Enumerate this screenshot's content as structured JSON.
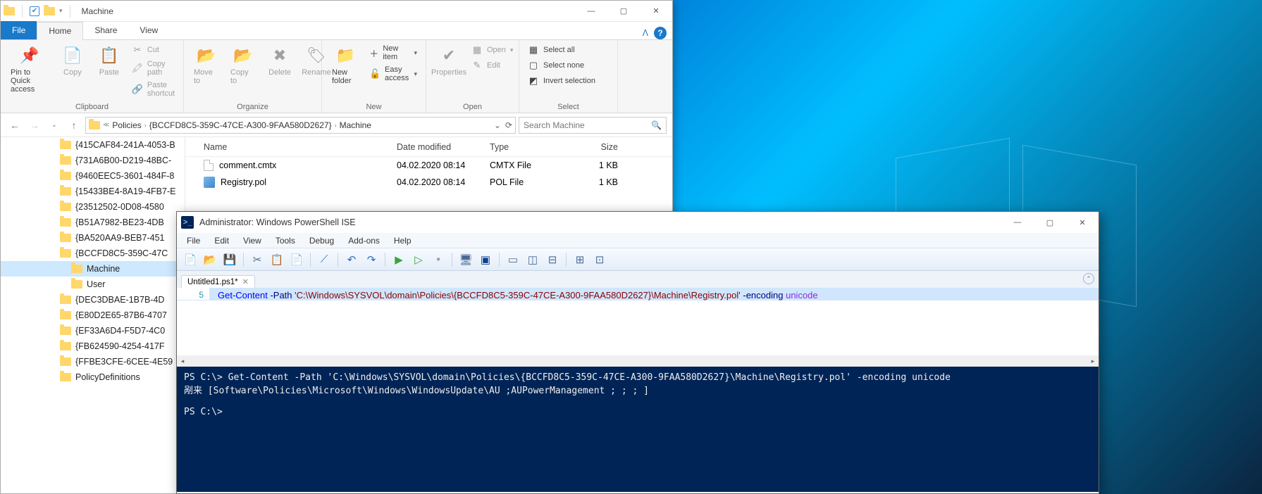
{
  "explorer": {
    "title": "Machine",
    "tabs": {
      "file": "File",
      "home": "Home",
      "share": "Share",
      "view": "View"
    },
    "ribbon": {
      "clipboard": {
        "label": "Clipboard",
        "pin": "Pin to Quick access",
        "copy": "Copy",
        "paste": "Paste",
        "cut": "Cut",
        "copypath": "Copy path",
        "pasteshort": "Paste shortcut"
      },
      "organize": {
        "label": "Organize",
        "moveto": "Move to",
        "copyto": "Copy to",
        "delete": "Delete",
        "rename": "Rename"
      },
      "new": {
        "label": "New",
        "newfolder": "New folder",
        "newitem": "New item",
        "easyaccess": "Easy access"
      },
      "open": {
        "label": "Open",
        "properties": "Properties",
        "open": "Open",
        "edit": "Edit"
      },
      "select": {
        "label": "Select",
        "all": "Select all",
        "none": "Select none",
        "invert": "Invert selection"
      }
    },
    "breadcrumb": {
      "a": "Policies",
      "b": "{BCCFD8C5-359C-47CE-A300-9FAA580D2627}",
      "c": "Machine"
    },
    "search_placeholder": "Search Machine",
    "tree": [
      "{415CAF84-241A-4053-B",
      "{731A6B00-D219-48BC-",
      "{9460EEC5-3601-484F-8",
      "{15433BE4-8A19-4FB7-E",
      "{23512502-0D08-4580",
      "{B51A7982-BE23-4DB",
      "{BA520AA9-BEB7-451",
      "{BCCFD8C5-359C-47C"
    ],
    "tree_children": [
      "Machine",
      "User"
    ],
    "tree_after": [
      "{DEC3DBAE-1B7B-4D",
      "{E80D2E65-87B6-4707",
      "{EF33A6D4-F5D7-4C0",
      "{FB624590-4254-417F",
      "{FFBE3CFE-6CEE-4E59",
      "PolicyDefinitions"
    ],
    "columns": {
      "name": "Name",
      "date": "Date modified",
      "type": "Type",
      "size": "Size"
    },
    "files": [
      {
        "name": "comment.cmtx",
        "date": "04.02.2020 08:14",
        "type": "CMTX File",
        "size": "1 KB",
        "icon": "file"
      },
      {
        "name": "Registry.pol",
        "date": "04.02.2020 08:14",
        "type": "POL File",
        "size": "1 KB",
        "icon": "pol"
      }
    ]
  },
  "ise": {
    "title": "Administrator: Windows PowerShell ISE",
    "menu": [
      "File",
      "Edit",
      "View",
      "Tools",
      "Debug",
      "Add-ons",
      "Help"
    ],
    "tab": "Untitled1.ps1*",
    "line_no": "5",
    "code": {
      "cmd": "Get-Content",
      "p1": " -Path ",
      "str": "'C:\\Windows\\SYSVOL\\domain\\Policies\\{BCCFD8C5-359C-47CE-A300-9FAA580D2627}\\Machine\\Registry.pol'",
      "p2": " -encoding ",
      "val": "unicode"
    },
    "console_lines": [
      "PS C:\\> Get-Content -Path 'C:\\Windows\\SYSVOL\\domain\\Policies\\{BCCFD8C5-359C-47CE-A300-9FAA580D2627}\\Machine\\Registry.pol' -encoding unicode",
      "剐来 [Software\\Policies\\Microsoft\\Windows\\WindowsUpdate\\AU ;AUPowerManagement ; ; ; ]",
      "",
      "PS C:\\> "
    ]
  }
}
